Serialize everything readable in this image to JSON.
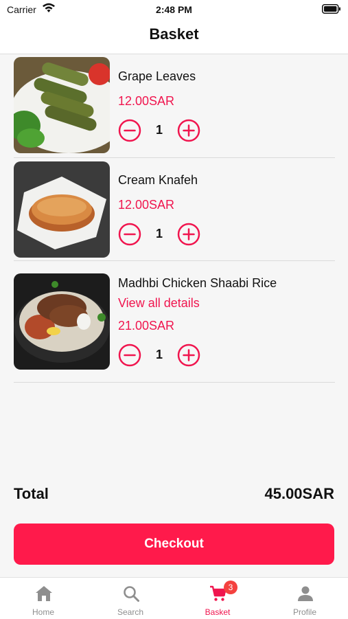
{
  "status": {
    "carrier": "Carrier",
    "time": "2:48 PM"
  },
  "header": {
    "title": "Basket"
  },
  "items": [
    {
      "name": "Grape Leaves",
      "price": "12.00SAR",
      "qty": "1"
    },
    {
      "name": "Cream Knafeh",
      "price": "12.00SAR",
      "qty": "1"
    },
    {
      "name": "Madhbi Chicken Shaabi Rice",
      "details_link": "View all details",
      "price": "21.00SAR",
      "qty": "1"
    }
  ],
  "summary": {
    "total_label": "Total",
    "total_value": "45.00SAR",
    "checkout_label": "Checkout"
  },
  "tabs": [
    {
      "label": "Home",
      "icon": "home-icon"
    },
    {
      "label": "Search",
      "icon": "search-icon"
    },
    {
      "label": "Basket",
      "icon": "cart-icon",
      "badge": "3",
      "active": true
    },
    {
      "label": "Profile",
      "icon": "person-icon"
    }
  ],
  "colors": {
    "accent": "#ff1a4b",
    "price": "#f0154e",
    "badge": "#f4413f",
    "inactive": "#8e8e8e"
  }
}
